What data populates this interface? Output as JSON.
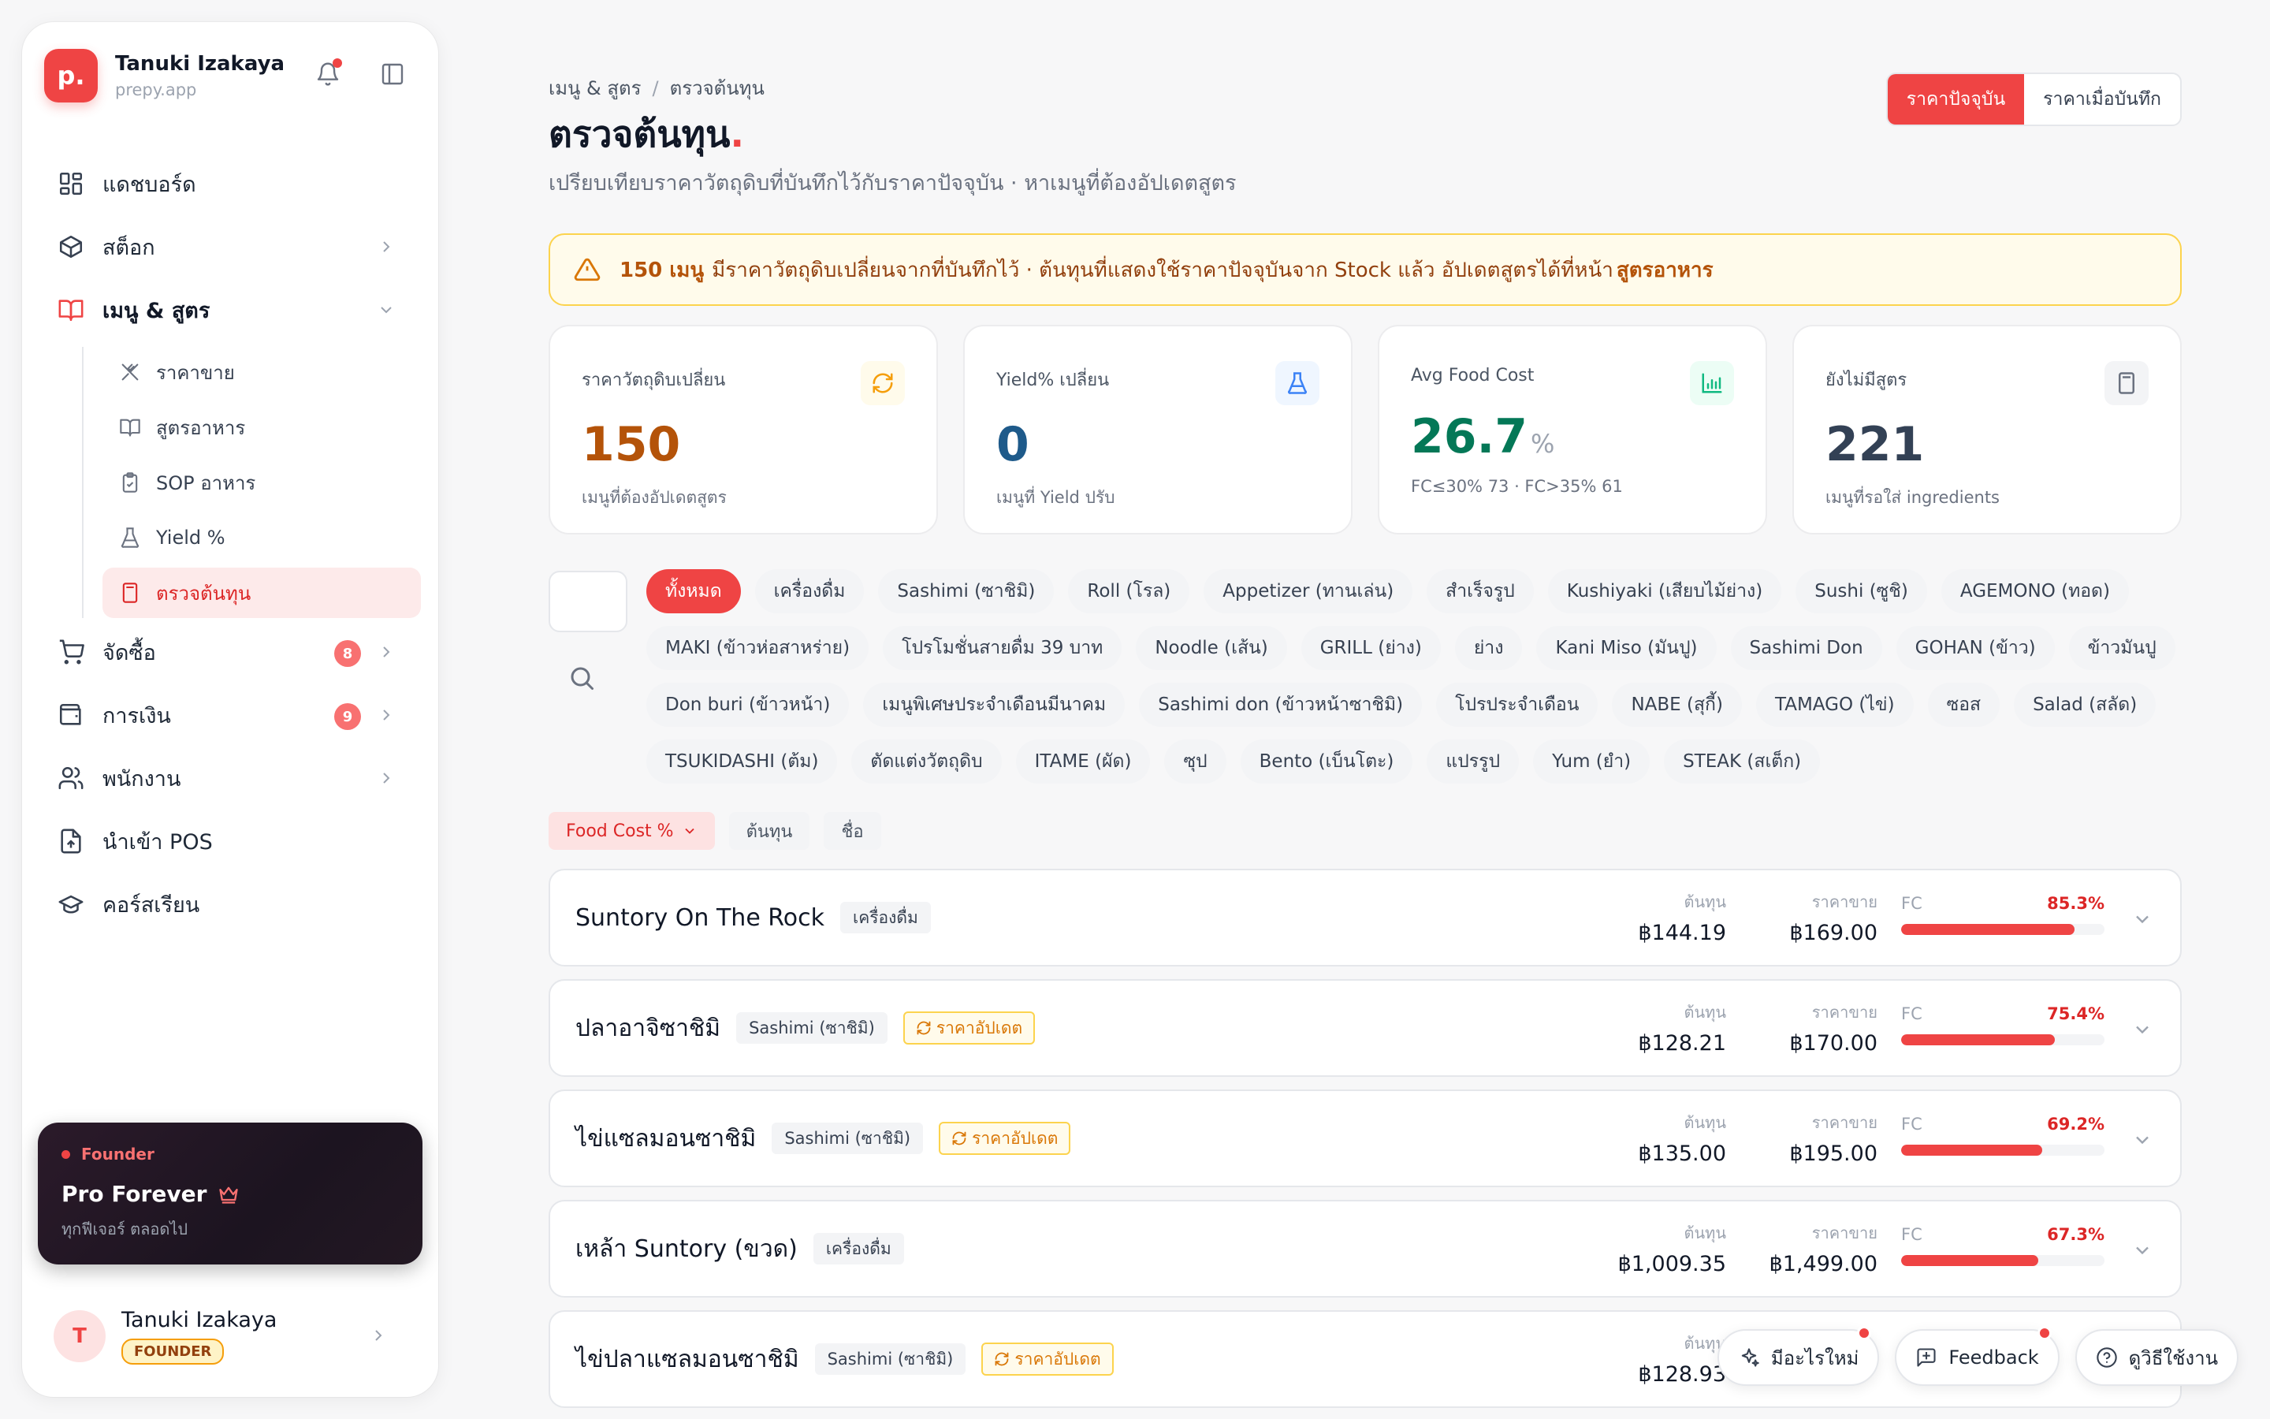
{
  "brand": {
    "logo_letter": "p.",
    "name": "Tanuki Izakaya",
    "domain": "prepy.app"
  },
  "nav": {
    "dashboard": "แดชบอร์ด",
    "stock": "สต็อก",
    "menu_recipes": "เมนู & สูตร",
    "sub": {
      "selling_price": "ราคาขาย",
      "recipes": "สูตรอาหาร",
      "sop": "SOP อาหาร",
      "yield": "Yield %",
      "cost_check": "ตรวจต้นทุน"
    },
    "purchasing": "จัดซื้อ",
    "purchasing_badge": "8",
    "finance": "การเงิน",
    "finance_badge": "9",
    "staff": "พนักงาน",
    "pos_import": "นำเข้า POS",
    "courses": "คอร์สเรียน"
  },
  "promo": {
    "tag": "Founder",
    "title": "Pro Forever",
    "subtitle": "ทุกฟีเจอร์ ตลอดไป"
  },
  "user": {
    "initial": "T",
    "name": "Tanuki Izakaya",
    "role": "FOUNDER"
  },
  "header": {
    "breadcrumb_parent": "เมนู & สูตร",
    "breadcrumb_sep": "/",
    "breadcrumb_current": "ตรวจต้นทุน",
    "title": "ตรวจต้นทุน",
    "title_dot": ".",
    "subtitle": "เปรียบเทียบราคาวัตถุดิบที่บันทึกไว้กับราคาปัจจุบัน · หาเมนูที่ต้องอัปเดตสูตร",
    "toggle_current": "ราคาปัจจุบัน",
    "toggle_saved": "ราคาเมื่อบันทึก"
  },
  "alert": {
    "count": "150 เมนู",
    "text": "มีราคาวัตถุดิบเปลี่ยนจากที่บันทึกไว้ · ต้นทุนที่แสดงใช้ราคาปัจจุบันจาก Stock แล้ว อัปเดตสูตรได้ที่หน้า ",
    "link": "สูตรอาหาร"
  },
  "stats": [
    {
      "label": "ราคาวัตถุดิบเปลี่ยน",
      "value": "150",
      "unit": "",
      "note": "เมนูที่ต้องอัปเดตสูตร",
      "color": "#b45309",
      "icon": "refresh-icon"
    },
    {
      "label": "Yield% เปลี่ยน",
      "value": "0",
      "unit": "",
      "note": "เมนูที่ Yield ปรับ",
      "color": "#1e5a8a",
      "icon": "flask-icon"
    },
    {
      "label": "Avg Food Cost",
      "value": "26.7",
      "unit": "%",
      "note": "FC≤30% 73 · FC>35% 61",
      "color": "#047857",
      "icon": "chart-icon"
    },
    {
      "label": "ยังไม่มีสูตร",
      "value": "221",
      "unit": "",
      "note": "เมนูที่รอใส่ ingredients",
      "color": "#334155",
      "icon": "calculator-icon"
    }
  ],
  "chips": [
    "ทั้งหมด",
    "เครื่องดื่ม",
    "Sashimi (ซาชิมิ)",
    "Roll (โรล)",
    "Appetizer (ทานเล่น)",
    "สำเร็จรูป",
    "Kushiyaki (เสียบไม้ย่าง)",
    "Sushi (ซูชิ)",
    "AGEMONO (ทอด)",
    "MAKI (ข้าวห่อสาหร่าย)",
    "โปรโมชั่นสายดื่ม 39 บาท",
    "Noodle (เส้น)",
    "GRILL (ย่าง)",
    "ย่าง",
    "Kani Miso (มันปู)",
    "Sashimi Don",
    "GOHAN (ข้าว)",
    "ข้าวมันปู",
    "Don buri (ข้าวหน้า)",
    "เมนูพิเศษประจำเดือนมีนาคม",
    "Sashimi don (ข้าวหน้าซาชิมิ)",
    "โปรประจำเดือน",
    "NABE (สุกี้)",
    "TAMAGO (ไข่)",
    "ซอส",
    "Salad (สลัด)",
    "TSUKIDASHI (ต้ม)",
    "ตัดแต่งวัตถุดิบ",
    "ITAME (ผัด)",
    "ซุป",
    "Bento (เบ็นโตะ)",
    "แปรรูป",
    "Yum (ยำ)",
    "STEAK (สเต็ก)"
  ],
  "sort": {
    "food_cost": "Food Cost %",
    "cost": "ต้นทุน",
    "name": "ชื่อ"
  },
  "labels": {
    "cost": "ต้นทุน",
    "price": "ราคาขาย",
    "fc": "FC",
    "updated": "ราคาอัปเดต"
  },
  "rows": [
    {
      "name": "Suntory On The Rock",
      "category": "เครื่องดื่ม",
      "updated": false,
      "cost": "฿144.19",
      "price": "฿169.00",
      "fc_text": "85.3%",
      "fc": 85.3
    },
    {
      "name": "ปลาอาจิซาชิมิ",
      "category": "Sashimi (ซาชิมิ)",
      "updated": true,
      "cost": "฿128.21",
      "price": "฿170.00",
      "fc_text": "75.4%",
      "fc": 75.4
    },
    {
      "name": "ไข่แซลมอนซาชิมิ",
      "category": "Sashimi (ซาชิมิ)",
      "updated": true,
      "cost": "฿135.00",
      "price": "฿195.00",
      "fc_text": "69.2%",
      "fc": 69.2
    },
    {
      "name": "เหล้า Suntory (ขวด)",
      "category": "เครื่องดื่ม",
      "updated": false,
      "cost": "฿1,009.35",
      "price": "฿1,499.00",
      "fc_text": "67.3%",
      "fc": 67.3
    },
    {
      "name": "ไข่ปลาแซลมอนซาชิมิ",
      "category": "Sashimi (ซาชิมิ)",
      "updated": true,
      "cost": "฿128.93",
      "price": "",
      "fc_text": "",
      "fc": null
    }
  ],
  "floating": {
    "whats_new": "มีอะไรใหม่",
    "feedback": "Feedback",
    "guide": "ดูวิธีใช้งาน"
  }
}
